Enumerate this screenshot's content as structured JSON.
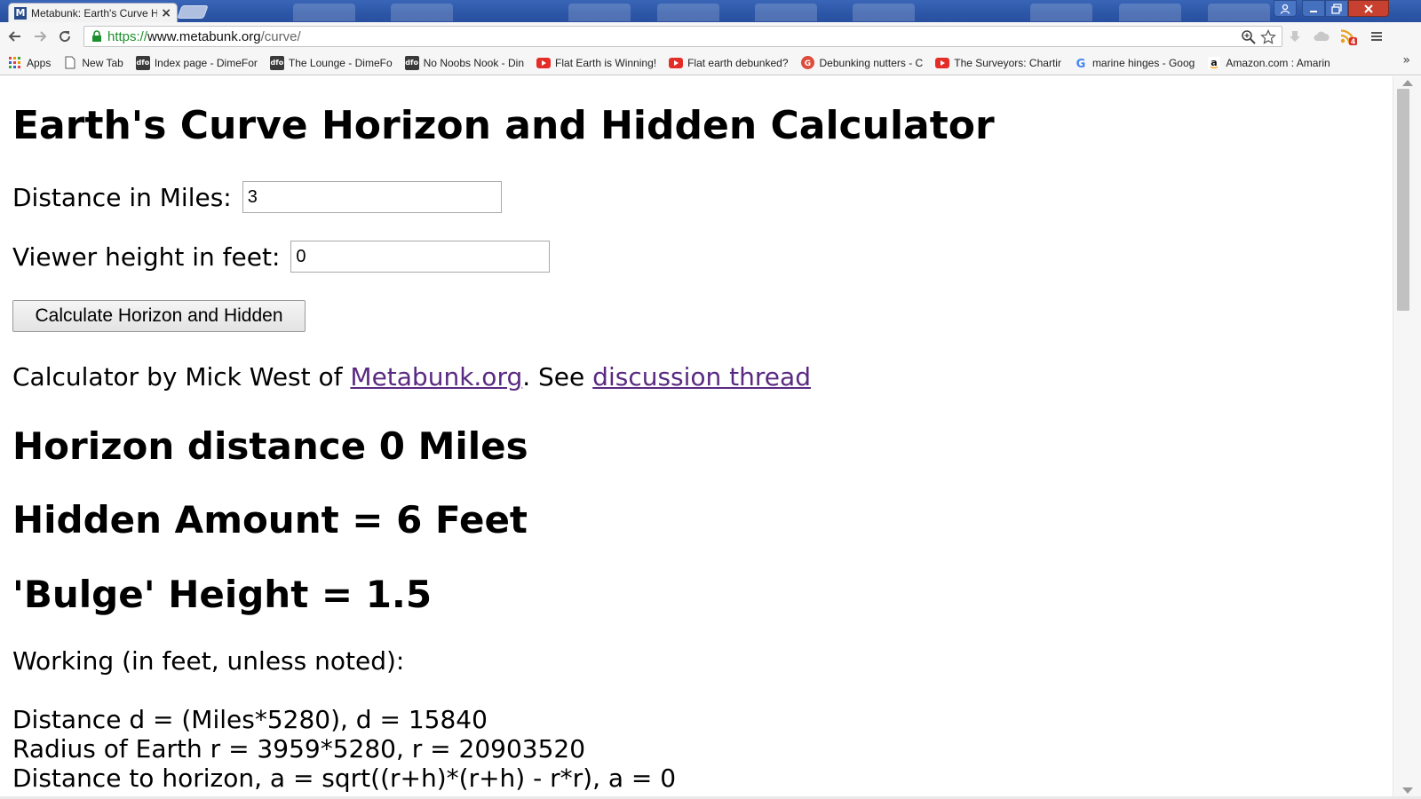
{
  "browser": {
    "tab": {
      "favicon_letter": "M",
      "title": "Metabunk: Earth's Curve H",
      "close": "×"
    },
    "url": {
      "scheme": "https://",
      "host": "www.metabunk.org",
      "path": "/curve/"
    },
    "rss_badge": "4",
    "bookmarks": [
      {
        "label": "Apps",
        "icon": "apps-grid-icon"
      },
      {
        "label": "New Tab",
        "icon": "page-icon"
      },
      {
        "label": "Index page - DimeFor",
        "icon": "dfo-icon"
      },
      {
        "label": "The Lounge - DimeFo",
        "icon": "dfo-icon"
      },
      {
        "label": "No Noobs Nook - Din",
        "icon": "dfo-icon"
      },
      {
        "label": "Flat Earth is Winning!",
        "icon": "youtube-icon"
      },
      {
        "label": "Flat earth debunked?",
        "icon": "youtube-icon"
      },
      {
        "label": "Debunking nutters - C",
        "icon": "google-plus-icon"
      },
      {
        "label": "The Surveyors: Chartir",
        "icon": "youtube-icon"
      },
      {
        "label": "marine hinges - Goog",
        "icon": "google-icon"
      },
      {
        "label": "Amazon.com : Amarin",
        "icon": "amazon-icon"
      }
    ],
    "overflow": "»"
  },
  "page": {
    "title": "Earth's Curve Horizon and Hidden Calculator",
    "distance": {
      "label": "Distance in Miles:",
      "value": "3"
    },
    "height": {
      "label": "Viewer height in feet:",
      "value": "0"
    },
    "calculate_label": "Calculate Horizon and Hidden",
    "credit": {
      "prefix": "Calculator by Mick West of ",
      "link1": "Metabunk.org",
      "middle": ". See ",
      "link2": "discussion thread"
    },
    "results": {
      "horizon": "Horizon distance 0 Miles",
      "hidden": "Hidden Amount = 6 Feet",
      "bulge": "'Bulge' Height = 1.5"
    },
    "working_heading": "Working (in feet, unless noted):",
    "working_lines": [
      "Distance d = (Miles*5280), d = 15840",
      "Radius of Earth r = 3959*5280, r = 20903520",
      "Distance to horizon, a = sqrt((r+h)*(r+h) - r*r), a = 0"
    ]
  },
  "colors": {
    "titlebar": "#2c56a6",
    "url_scheme": "#1e8f2e",
    "visited_link": "#5a2a82",
    "close_button": "#c8402f"
  }
}
